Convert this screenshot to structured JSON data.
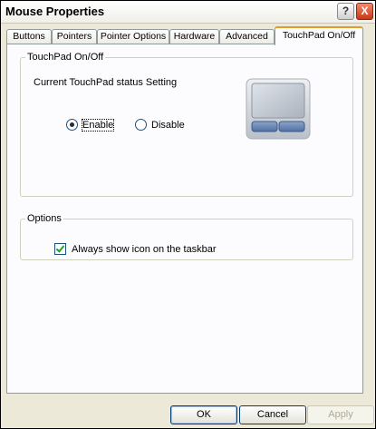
{
  "window": {
    "title": "Mouse Properties"
  },
  "title_buttons": {
    "help": "?",
    "close": "X"
  },
  "tabs": [
    {
      "label": "Buttons",
      "active": false
    },
    {
      "label": "Pointers",
      "active": false
    },
    {
      "label": "Pointer Options",
      "active": false
    },
    {
      "label": "Hardware",
      "active": false
    },
    {
      "label": "Advanced",
      "active": false
    },
    {
      "label": "TouchPad On/Off",
      "active": true
    }
  ],
  "touchpad_group": {
    "legend": "TouchPad On/Off",
    "status_label": "Current TouchPad status Setting",
    "enable_label": "Enable",
    "disable_label": "Disable",
    "selected": "Enable"
  },
  "options_group": {
    "legend": "Options",
    "always_show_label": "Always show icon on the taskbar",
    "always_show_checked": true
  },
  "buttons": {
    "ok": "OK",
    "cancel": "Cancel",
    "apply": "Apply"
  },
  "colors": {
    "window_bg": "#ECE9D8",
    "active_tab_accent": "#E69A2A",
    "close_red": "#C8381A"
  }
}
